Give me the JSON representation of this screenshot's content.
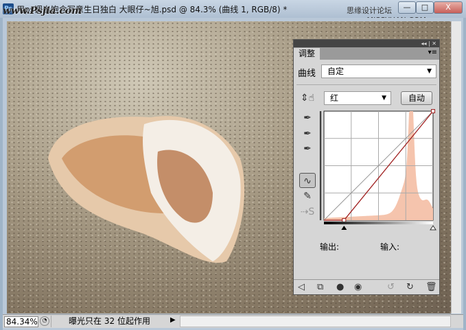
{
  "window": {
    "title": "用ps调出饱含写意生日独白 大眼仔~旭.psd @ 84.3% (曲线 1, RGB/8) *",
    "app_icon": "Ps",
    "watermark_left": "www.Psjia.com",
    "watermark_right": "思缘设计论坛 www.MISSYUAN.COM",
    "buttons": {
      "minimize": "—",
      "maximize": "□",
      "close": "X"
    }
  },
  "panel": {
    "tab": "调整",
    "preset_label": "曲线",
    "preset_value": "自定",
    "channel_value": "红",
    "auto_label": "自动",
    "output_label": "输出:",
    "input_label": "输入:",
    "icons": [
      "back-arrow-icon",
      "clip-layer-icon",
      "layer-visibility-mask-icon",
      "eye-icon",
      "reset-previous-icon",
      "reset-icon",
      "trash-icon"
    ]
  },
  "curve": {
    "points": [
      [
        0,
        0
      ],
      [
        47,
        0
      ],
      [
        255,
        255
      ]
    ],
    "histogram_color": "#f5c4ad",
    "curve_color": "#a02020"
  },
  "status": {
    "zoom": "84.34%",
    "message": "曝光只在 32 位起作用"
  }
}
